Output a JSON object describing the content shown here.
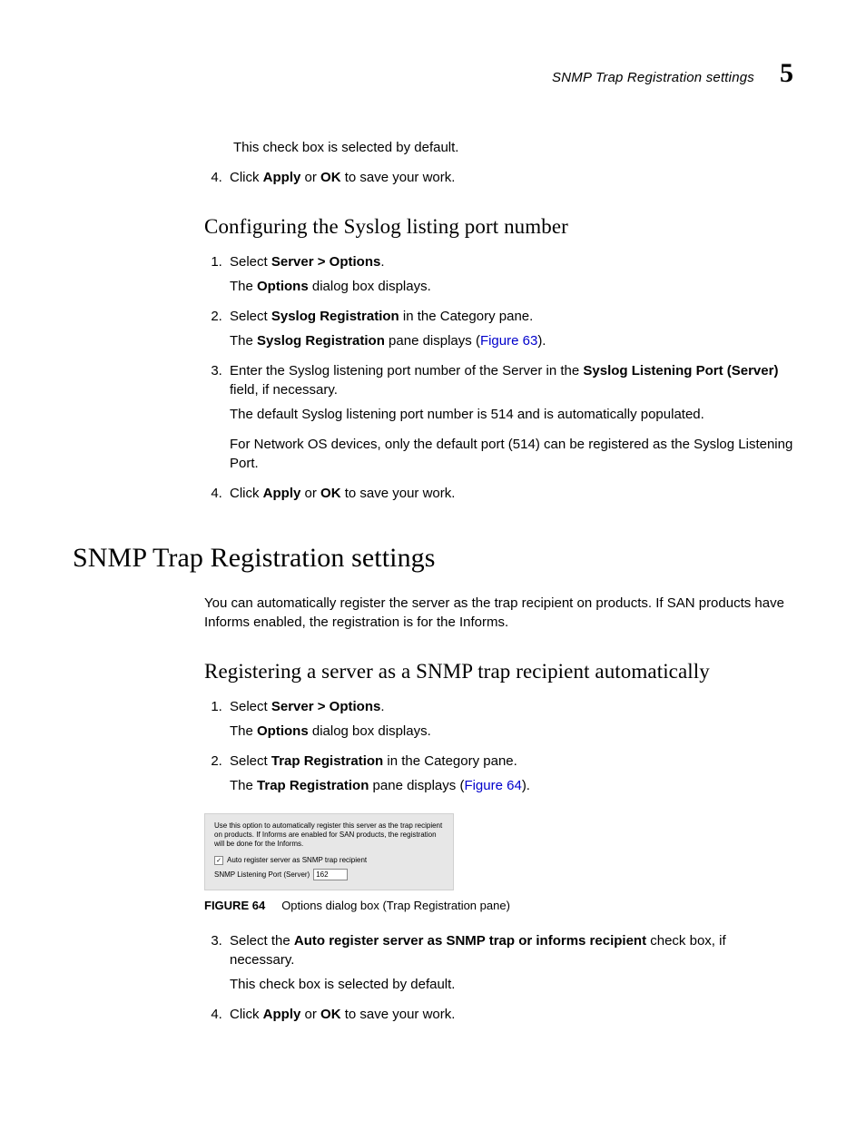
{
  "header": {
    "running_title": "SNMP Trap Registration settings",
    "chapter_number": "5"
  },
  "top": {
    "precheck_note": "This check box is selected by default.",
    "step4_prefix": "Click ",
    "apply": "Apply",
    "or": " or ",
    "ok": "OK",
    "step4_suffix": " to save your work."
  },
  "syslog": {
    "heading": "Configuring the Syslog listing port number",
    "s1_prefix": "Select ",
    "s1_bold": "Server > Options",
    "s1_suffix": ".",
    "s1_body_a": "The ",
    "s1_body_b": "Options",
    "s1_body_c": " dialog box displays.",
    "s2_prefix": "Select ",
    "s2_bold": "Syslog Registration",
    "s2_suffix": " in the Category pane.",
    "s2_body_a": "The ",
    "s2_body_b": "Syslog Registration",
    "s2_body_c": " pane displays (",
    "s2_link": "Figure 63",
    "s2_body_d": ").",
    "s3_prefix": "Enter the Syslog listening port number of the Server in the ",
    "s3_bold": "Syslog Listening Port (Server)",
    "s3_suffix": " field, if necessary.",
    "s3_body1": "The default Syslog listening port number is 514 and is automatically populated.",
    "s3_body2": "For Network OS devices, only the default port (514) can be registered as the Syslog Listening Port.",
    "s4_prefix": "Click ",
    "s4_apply": "Apply",
    "s4_or": " or ",
    "s4_ok": "OK",
    "s4_suffix": " to save your work."
  },
  "snmp": {
    "h1": "SNMP Trap Registration settings",
    "intro": "You can automatically register the server as the trap recipient on products. If SAN products have Informs enabled, the registration is for the Informs.",
    "h2": "Registering a server as a SNMP trap recipient automatically",
    "s1_prefix": "Select ",
    "s1_bold": "Server > Options",
    "s1_suffix": ".",
    "s1_body_a": "The ",
    "s1_body_b": "Options",
    "s1_body_c": " dialog box displays.",
    "s2_prefix": "Select ",
    "s2_bold": "Trap Registration",
    "s2_suffix": " in the Category pane.",
    "s2_body_a": "The ",
    "s2_body_b": "Trap Registration",
    "s2_body_c": " pane displays (",
    "s2_link": "Figure 64",
    "s2_body_d": ").",
    "figure": {
      "desc": "Use this option to automatically register this server as the trap recipient on products. If Informs are enabled for SAN products, the registration will be done for the Informs.",
      "checkbox_label": "Auto register server as SNMP trap recipient",
      "port_label": "SNMP Listening Port (Server)",
      "port_value": "162",
      "checkbox_checked": "✓"
    },
    "caption_label": "FIGURE 64",
    "caption_text": "Options dialog box (Trap Registration pane)",
    "s3_prefix": "Select the ",
    "s3_bold": "Auto register server as SNMP trap or informs recipient",
    "s3_suffix": " check box, if necessary.",
    "s3_body": "This check box is selected by default.",
    "s4_prefix": "Click ",
    "s4_apply": "Apply",
    "s4_or": " or ",
    "s4_ok": "OK",
    "s4_suffix": " to save your work."
  }
}
